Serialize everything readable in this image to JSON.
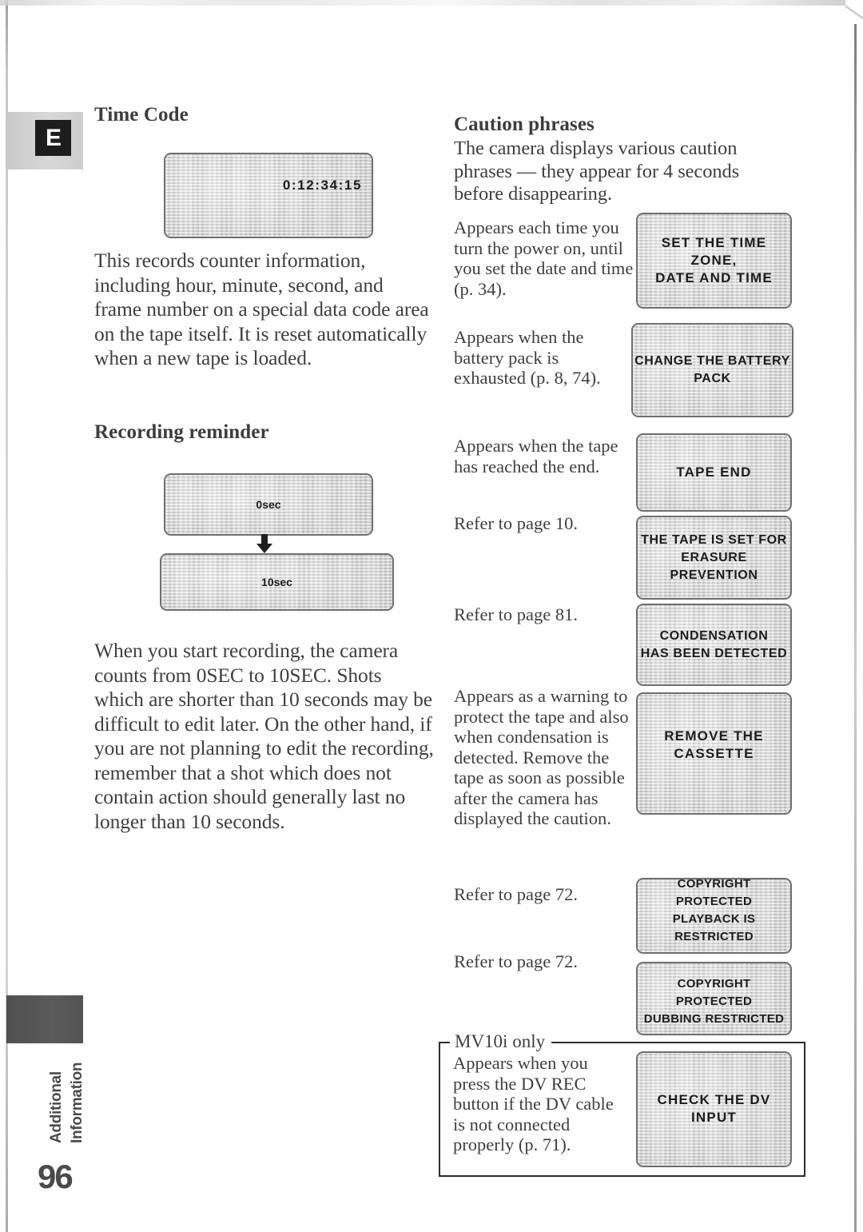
{
  "page": {
    "number": "96",
    "section_label_line1": "Additional",
    "section_label_line2": "Information",
    "language_badge": "E"
  },
  "left_column": {
    "heading_time_code": "Time Code",
    "timecode_display": "0:12:34:15",
    "time_code_body": "This records counter information, including hour, minute, second, and frame number on a special data code area on the tape itself. It is reset automatically when a new tape is loaded.",
    "heading_recording_reminder": "Recording reminder",
    "reminder_display_start": "0sec",
    "reminder_display_end": "10sec",
    "recording_reminder_body": "When you start recording, the camera counts from 0SEC to 10SEC. Shots which are shorter than 10 seconds may be difficult to edit later. On the other hand, if you are not planning to edit the recording, remember that a shot which does not contain action should generally last no longer than 10 seconds."
  },
  "right_column": {
    "heading_caution_phrases": "Caution phrases",
    "caution_intro": "The camera displays various caution phrases — they appear for 4 seconds before disappearing.",
    "cautions": [
      {
        "description": "Appears each time you turn the power on, until you set the date and time (p. 34).",
        "display": "SET THE TIME ZONE,\nDATE AND TIME"
      },
      {
        "description": "Appears when the battery pack is exhausted (p. 8, 74).",
        "display": "CHANGE THE BATTERY PACK"
      },
      {
        "description": "Appears when the tape has reached the end.",
        "display": "TAPE END"
      },
      {
        "description": "Refer to page 10.",
        "display": "THE TAPE IS SET FOR\nERASURE PREVENTION"
      },
      {
        "description": "Refer to page 81.",
        "display": "CONDENSATION\nHAS BEEN DETECTED"
      },
      {
        "description": "Appears as a warning to protect the tape and also when condensation is detected. Remove the tape as soon as possible after the camera has displayed the caution.",
        "display": "REMOVE THE CASSETTE"
      },
      {
        "description": "Refer to page 72.",
        "display": "COPYRIGHT PROTECTED\nPLAYBACK IS RESTRICTED"
      },
      {
        "description": "Refer to page 72.",
        "display": "COPYRIGHT PROTECTED\nDUBBING RESTRICTED"
      }
    ],
    "mv10i_box": {
      "legend": "MV10i only",
      "description": "Appears when you press the DV REC button if the DV cable is not connected properly (p. 71).",
      "display": "CHECK THE DV INPUT"
    }
  }
}
